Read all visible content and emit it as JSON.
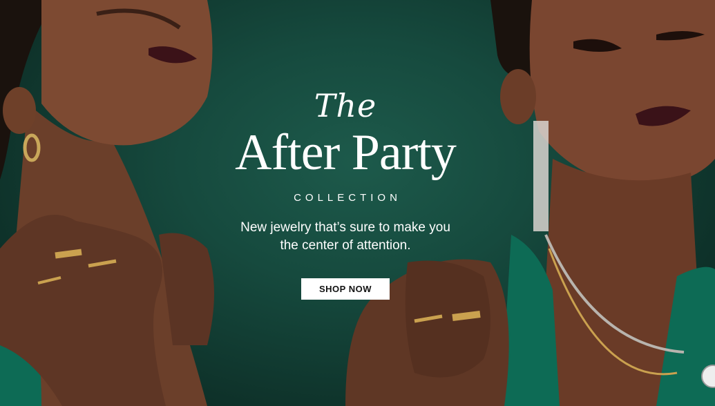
{
  "hero": {
    "title_prefix": "The",
    "title_main": "After Party",
    "subtitle": "COLLECTION",
    "description": "New jewelry that’s sure to make you the center of attention.",
    "cta_label": "SHOP NOW"
  },
  "colors": {
    "background": "#164a3e",
    "text": "#ffffff",
    "button_bg": "#ffffff",
    "button_text": "#111111",
    "dress": "#0d6b55"
  }
}
